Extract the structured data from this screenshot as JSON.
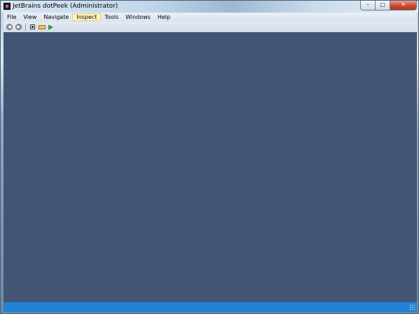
{
  "window": {
    "title": "JetBrains dotPeek (Administrator)",
    "controls": {
      "minimize": "–",
      "maximize": "□",
      "close": "✕"
    }
  },
  "menu": {
    "items": [
      {
        "label": "File"
      },
      {
        "label": "View"
      },
      {
        "label": "Navigate"
      },
      {
        "label": "Inspect",
        "active": true
      },
      {
        "label": "Tools"
      },
      {
        "label": "Windows"
      },
      {
        "label": "Help"
      }
    ]
  },
  "toolbar": {
    "icons": [
      "back-arrow-icon",
      "forward-arrow-icon",
      "assembly-explorer-icon",
      "tag-icon",
      "run-icon"
    ]
  },
  "colors": {
    "workspace": "#425575",
    "statusbar": "#1f82d4",
    "menu_highlight": "#fdf3bf"
  }
}
